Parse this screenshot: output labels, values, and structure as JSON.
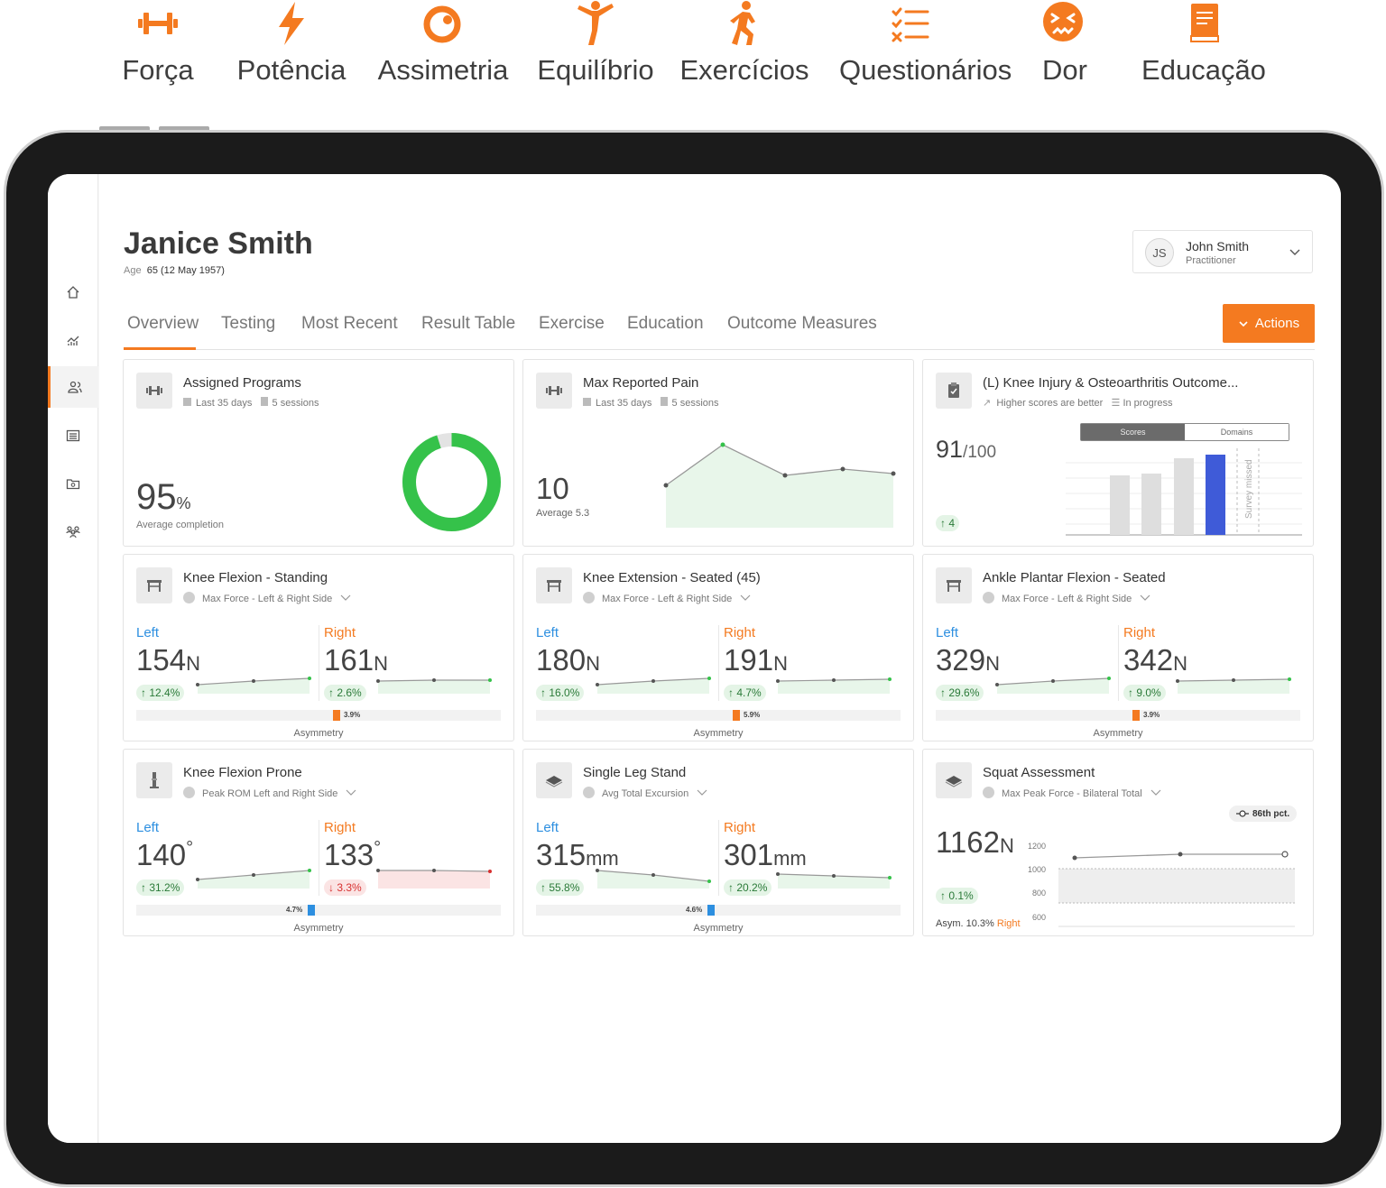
{
  "top_categories": [
    {
      "icon": "dumbbell-icon",
      "label": "Força"
    },
    {
      "icon": "lightning-icon",
      "label": "Potência"
    },
    {
      "icon": "asymmetry-icon",
      "label": "Assimetria"
    },
    {
      "icon": "balance-figure-icon",
      "label": "Equilíbrio"
    },
    {
      "icon": "walking-figure-icon",
      "label": "Exercícios"
    },
    {
      "icon": "checklist-icon",
      "label": "Questionários"
    },
    {
      "icon": "pain-face-icon",
      "label": "Dor"
    },
    {
      "icon": "book-icon",
      "label": "Educação"
    }
  ],
  "accent_color": "#f47a20",
  "sidebar": [
    "home-icon",
    "analytics-icon",
    "patients-icon",
    "list-icon",
    "folder-icon",
    "team-icon"
  ],
  "patient": {
    "name": "Janice Smith",
    "age_label": "Age",
    "age_value": "65 (12 May 1957)"
  },
  "user": {
    "initials": "JS",
    "name": "John Smith",
    "role": "Practitioner"
  },
  "tabs": [
    "Overview",
    "Testing",
    "Most Recent",
    "Result Table",
    "Exercise",
    "Education",
    "Outcome Measures"
  ],
  "actions_label": "Actions",
  "assigned": {
    "title": "Assigned Programs",
    "period": "Last 35 days",
    "sessions": "5 sessions",
    "value": "95",
    "unit": "%",
    "caption": "Average completion",
    "completion": 0.95
  },
  "pain": {
    "title": "Max Reported Pain",
    "period": "Last 35 days",
    "sessions": "5 sessions",
    "value": "10",
    "average": "Average  5.3"
  },
  "koos": {
    "title": "(L) Knee Injury & Osteoarthritis Outcome...",
    "note1": "Higher scores are better",
    "note2": "In progress",
    "toggle": [
      "Scores",
      "Domains"
    ],
    "value": "91",
    "of": "/100",
    "delta": "4",
    "missed": "Survey missed"
  },
  "asym_caption": "Asymmetry",
  "cards": [
    {
      "title": "Knee Flexion - Standing",
      "metric": "Max Force - Left & Right Side",
      "left_label": "Left",
      "right_label": "Right",
      "left": "154",
      "right": "161",
      "unit": "N",
      "left_delta": "12.4%",
      "right_delta": "2.6%",
      "right_down": false,
      "asym": "3.9%",
      "asym_side": "right"
    },
    {
      "title": "Knee Extension - Seated (45)",
      "metric": "Max Force - Left & Right Side",
      "left_label": "Left",
      "right_label": "Right",
      "left": "180",
      "right": "191",
      "unit": "N",
      "left_delta": "16.0%",
      "right_delta": "4.7%",
      "right_down": false,
      "asym": "5.9%",
      "asym_side": "right"
    },
    {
      "title": "Ankle Plantar Flexion - Seated",
      "metric": "Max Force - Left & Right Side",
      "left_label": "Left",
      "right_label": "Right",
      "left": "329",
      "right": "342",
      "unit": "N",
      "left_delta": "29.6%",
      "right_delta": "9.0%",
      "right_down": false,
      "asym": "3.9%",
      "asym_side": "right"
    },
    {
      "title": "Knee Flexion Prone",
      "metric": "Peak ROM Left and Right Side",
      "left_label": "Left",
      "right_label": "Right",
      "left": "140",
      "right": "133",
      "unit": "°",
      "left_delta": "31.2%",
      "right_delta": "3.3%",
      "right_down": true,
      "asym": "4.7%",
      "asym_side": "left"
    },
    {
      "title": "Single Leg Stand",
      "metric": "Avg Total Excursion",
      "left_label": "Left",
      "right_label": "Right",
      "left": "315",
      "right": "301",
      "unit": "mm",
      "left_delta": "55.8%",
      "right_delta": "20.2%",
      "right_down": false,
      "asym": "4.6%",
      "asym_side": "left"
    }
  ],
  "squat": {
    "title": "Squat Assessment",
    "metric": "Max Peak Force - Bilateral Total",
    "pct": "86th pct.",
    "value": "1162",
    "unit": "N",
    "delta": "0.1%",
    "asym_label": "Asym.",
    "asym_value": "10.3%",
    "asym_side": "Right",
    "yticks": [
      "1200",
      "1000",
      "800",
      "600"
    ]
  }
}
